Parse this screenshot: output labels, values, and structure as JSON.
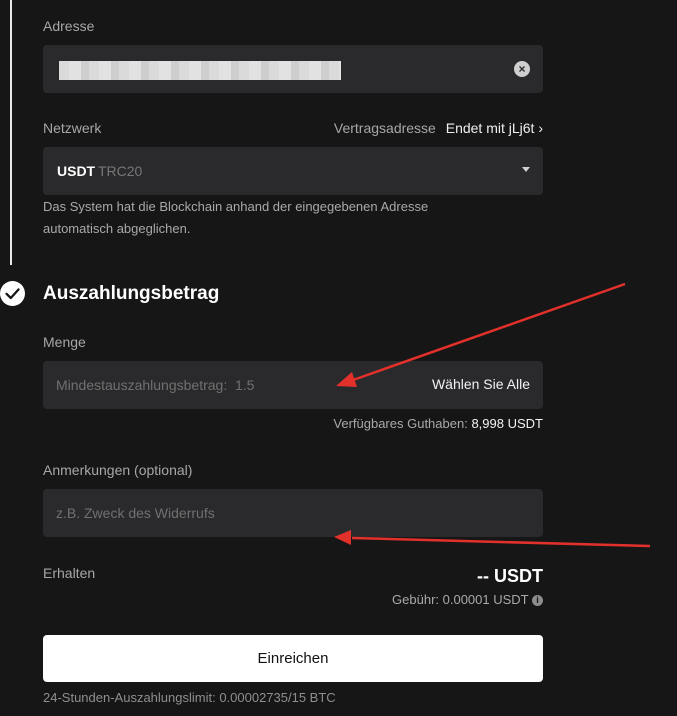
{
  "address": {
    "label": "Adresse"
  },
  "network": {
    "label": "Netzwerk",
    "contract_label": "Vertragsadresse",
    "contract_value": "Endet mit jLj6t ›",
    "selected_coin": "USDT",
    "selected_network": "TRC20",
    "note_line1": "Das System hat die Blockchain anhand der eingegebenen Adresse",
    "note_line2": "automatisch abgeglichen."
  },
  "section": {
    "title": "Auszahlungsbetrag"
  },
  "amount": {
    "label": "Menge",
    "placeholder": "Mindestauszahlungsbetrag:  1.5",
    "select_all": "Wählen Sie Alle",
    "available_label": "Verfügbares Guthaben:",
    "available_value": "8,998 USDT"
  },
  "remarks": {
    "label": "Anmerkungen (optional)",
    "placeholder": "z.B. Zweck des Widerrufs"
  },
  "receive": {
    "label": "Erhalten",
    "value": "-- USDT",
    "fee": "Gebühr: 0.00001 USDT"
  },
  "submit": {
    "label": "Einreichen"
  },
  "limit": {
    "text": "24-Stunden-Auszahlungslimit: 0.00002735/15 BTC"
  },
  "icons": {
    "clear": "clear-icon",
    "dropdown": "caret-down-icon",
    "check": "check-icon",
    "info": "info-icon"
  }
}
